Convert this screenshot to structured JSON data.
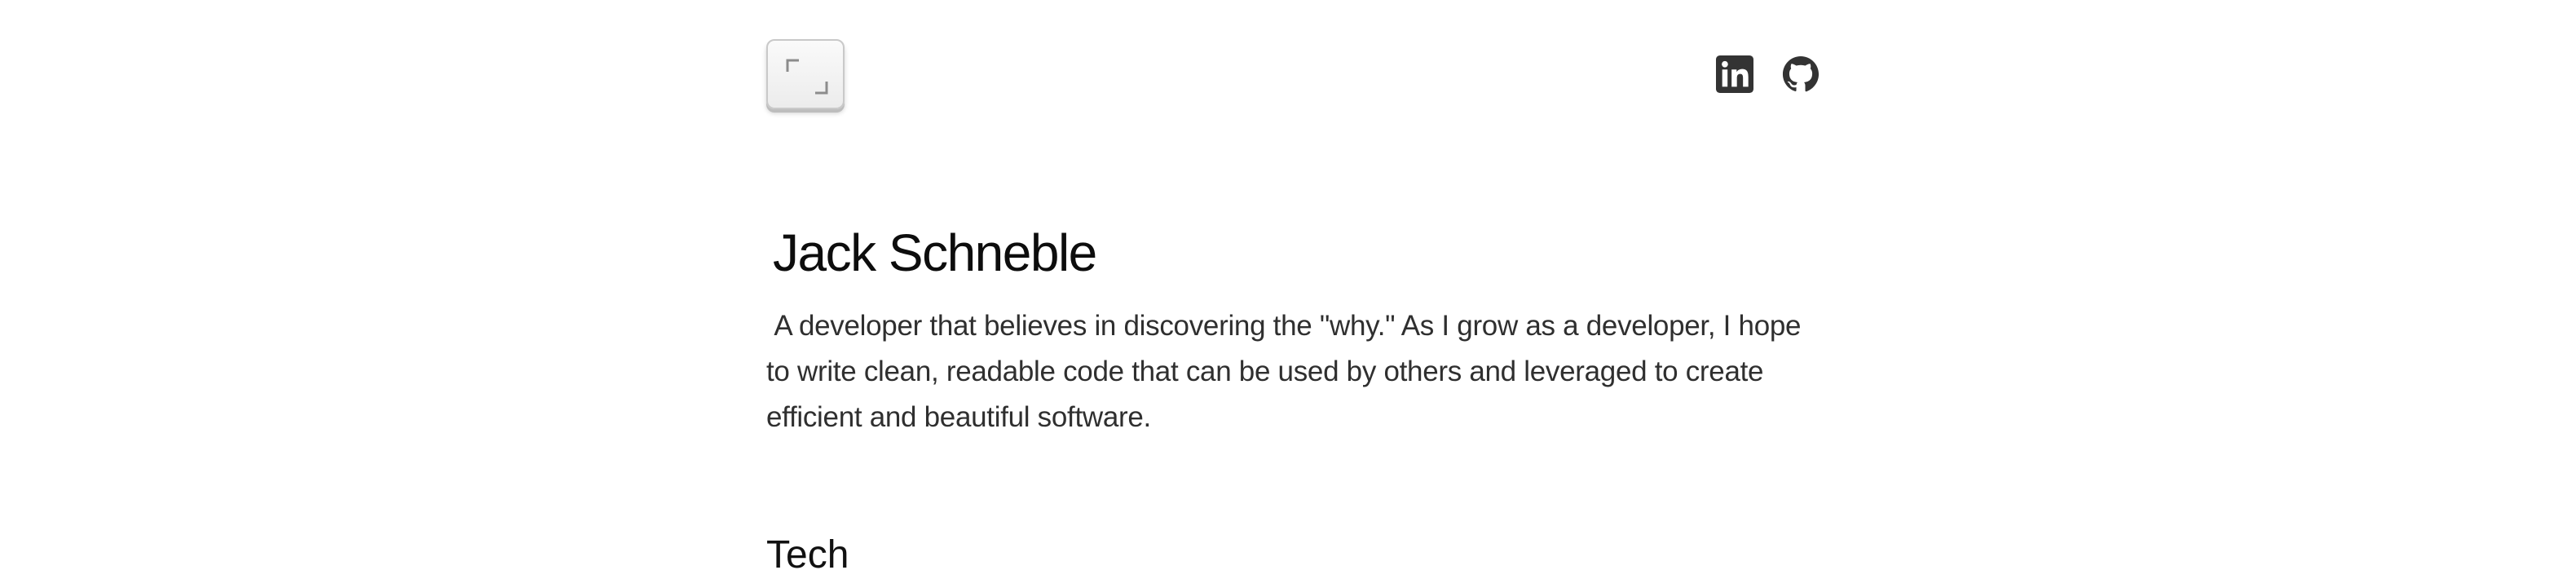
{
  "header": {
    "logo_icon": "keyboard-key-corner-brackets-icon",
    "social_links": [
      {
        "name": "LinkedIn",
        "icon": "linkedin-icon"
      },
      {
        "name": "GitHub",
        "icon": "github-icon"
      }
    ],
    "icon_color": "#333333"
  },
  "hero": {
    "name": "Jack Schneble",
    "bio": " A developer that believes in discovering the \"why.\" As I grow as a developer, I hope to write clean, readable code that can be used by others and leveraged to create efficient and beautiful software."
  },
  "sections": {
    "tech_heading": "Tech"
  }
}
